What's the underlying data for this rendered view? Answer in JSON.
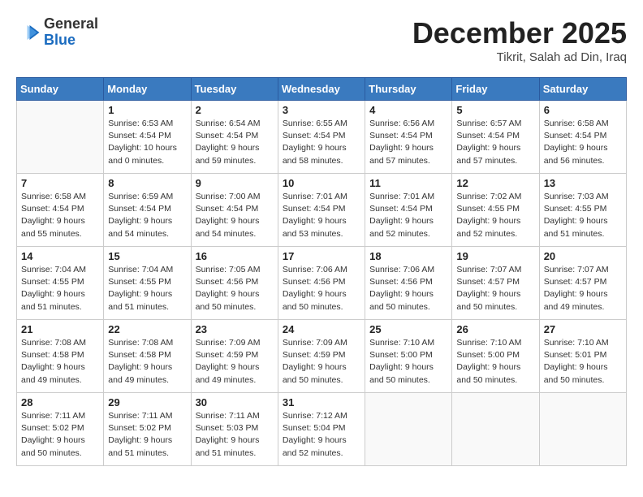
{
  "logo": {
    "general": "General",
    "blue": "Blue"
  },
  "header": {
    "month": "December 2025",
    "location": "Tikrit, Salah ad Din, Iraq"
  },
  "weekdays": [
    "Sunday",
    "Monday",
    "Tuesday",
    "Wednesday",
    "Thursday",
    "Friday",
    "Saturday"
  ],
  "weeks": [
    [
      {
        "day": "",
        "info": ""
      },
      {
        "day": "1",
        "info": "Sunrise: 6:53 AM\nSunset: 4:54 PM\nDaylight: 10 hours\nand 0 minutes."
      },
      {
        "day": "2",
        "info": "Sunrise: 6:54 AM\nSunset: 4:54 PM\nDaylight: 9 hours\nand 59 minutes."
      },
      {
        "day": "3",
        "info": "Sunrise: 6:55 AM\nSunset: 4:54 PM\nDaylight: 9 hours\nand 58 minutes."
      },
      {
        "day": "4",
        "info": "Sunrise: 6:56 AM\nSunset: 4:54 PM\nDaylight: 9 hours\nand 57 minutes."
      },
      {
        "day": "5",
        "info": "Sunrise: 6:57 AM\nSunset: 4:54 PM\nDaylight: 9 hours\nand 57 minutes."
      },
      {
        "day": "6",
        "info": "Sunrise: 6:58 AM\nSunset: 4:54 PM\nDaylight: 9 hours\nand 56 minutes."
      }
    ],
    [
      {
        "day": "7",
        "info": "Sunrise: 6:58 AM\nSunset: 4:54 PM\nDaylight: 9 hours\nand 55 minutes."
      },
      {
        "day": "8",
        "info": "Sunrise: 6:59 AM\nSunset: 4:54 PM\nDaylight: 9 hours\nand 54 minutes."
      },
      {
        "day": "9",
        "info": "Sunrise: 7:00 AM\nSunset: 4:54 PM\nDaylight: 9 hours\nand 54 minutes."
      },
      {
        "day": "10",
        "info": "Sunrise: 7:01 AM\nSunset: 4:54 PM\nDaylight: 9 hours\nand 53 minutes."
      },
      {
        "day": "11",
        "info": "Sunrise: 7:01 AM\nSunset: 4:54 PM\nDaylight: 9 hours\nand 52 minutes."
      },
      {
        "day": "12",
        "info": "Sunrise: 7:02 AM\nSunset: 4:55 PM\nDaylight: 9 hours\nand 52 minutes."
      },
      {
        "day": "13",
        "info": "Sunrise: 7:03 AM\nSunset: 4:55 PM\nDaylight: 9 hours\nand 51 minutes."
      }
    ],
    [
      {
        "day": "14",
        "info": "Sunrise: 7:04 AM\nSunset: 4:55 PM\nDaylight: 9 hours\nand 51 minutes."
      },
      {
        "day": "15",
        "info": "Sunrise: 7:04 AM\nSunset: 4:55 PM\nDaylight: 9 hours\nand 51 minutes."
      },
      {
        "day": "16",
        "info": "Sunrise: 7:05 AM\nSunset: 4:56 PM\nDaylight: 9 hours\nand 50 minutes."
      },
      {
        "day": "17",
        "info": "Sunrise: 7:06 AM\nSunset: 4:56 PM\nDaylight: 9 hours\nand 50 minutes."
      },
      {
        "day": "18",
        "info": "Sunrise: 7:06 AM\nSunset: 4:56 PM\nDaylight: 9 hours\nand 50 minutes."
      },
      {
        "day": "19",
        "info": "Sunrise: 7:07 AM\nSunset: 4:57 PM\nDaylight: 9 hours\nand 50 minutes."
      },
      {
        "day": "20",
        "info": "Sunrise: 7:07 AM\nSunset: 4:57 PM\nDaylight: 9 hours\nand 49 minutes."
      }
    ],
    [
      {
        "day": "21",
        "info": "Sunrise: 7:08 AM\nSunset: 4:58 PM\nDaylight: 9 hours\nand 49 minutes."
      },
      {
        "day": "22",
        "info": "Sunrise: 7:08 AM\nSunset: 4:58 PM\nDaylight: 9 hours\nand 49 minutes."
      },
      {
        "day": "23",
        "info": "Sunrise: 7:09 AM\nSunset: 4:59 PM\nDaylight: 9 hours\nand 49 minutes."
      },
      {
        "day": "24",
        "info": "Sunrise: 7:09 AM\nSunset: 4:59 PM\nDaylight: 9 hours\nand 50 minutes."
      },
      {
        "day": "25",
        "info": "Sunrise: 7:10 AM\nSunset: 5:00 PM\nDaylight: 9 hours\nand 50 minutes."
      },
      {
        "day": "26",
        "info": "Sunrise: 7:10 AM\nSunset: 5:00 PM\nDaylight: 9 hours\nand 50 minutes."
      },
      {
        "day": "27",
        "info": "Sunrise: 7:10 AM\nSunset: 5:01 PM\nDaylight: 9 hours\nand 50 minutes."
      }
    ],
    [
      {
        "day": "28",
        "info": "Sunrise: 7:11 AM\nSunset: 5:02 PM\nDaylight: 9 hours\nand 50 minutes."
      },
      {
        "day": "29",
        "info": "Sunrise: 7:11 AM\nSunset: 5:02 PM\nDaylight: 9 hours\nand 51 minutes."
      },
      {
        "day": "30",
        "info": "Sunrise: 7:11 AM\nSunset: 5:03 PM\nDaylight: 9 hours\nand 51 minutes."
      },
      {
        "day": "31",
        "info": "Sunrise: 7:12 AM\nSunset: 5:04 PM\nDaylight: 9 hours\nand 52 minutes."
      },
      {
        "day": "",
        "info": ""
      },
      {
        "day": "",
        "info": ""
      },
      {
        "day": "",
        "info": ""
      }
    ]
  ]
}
